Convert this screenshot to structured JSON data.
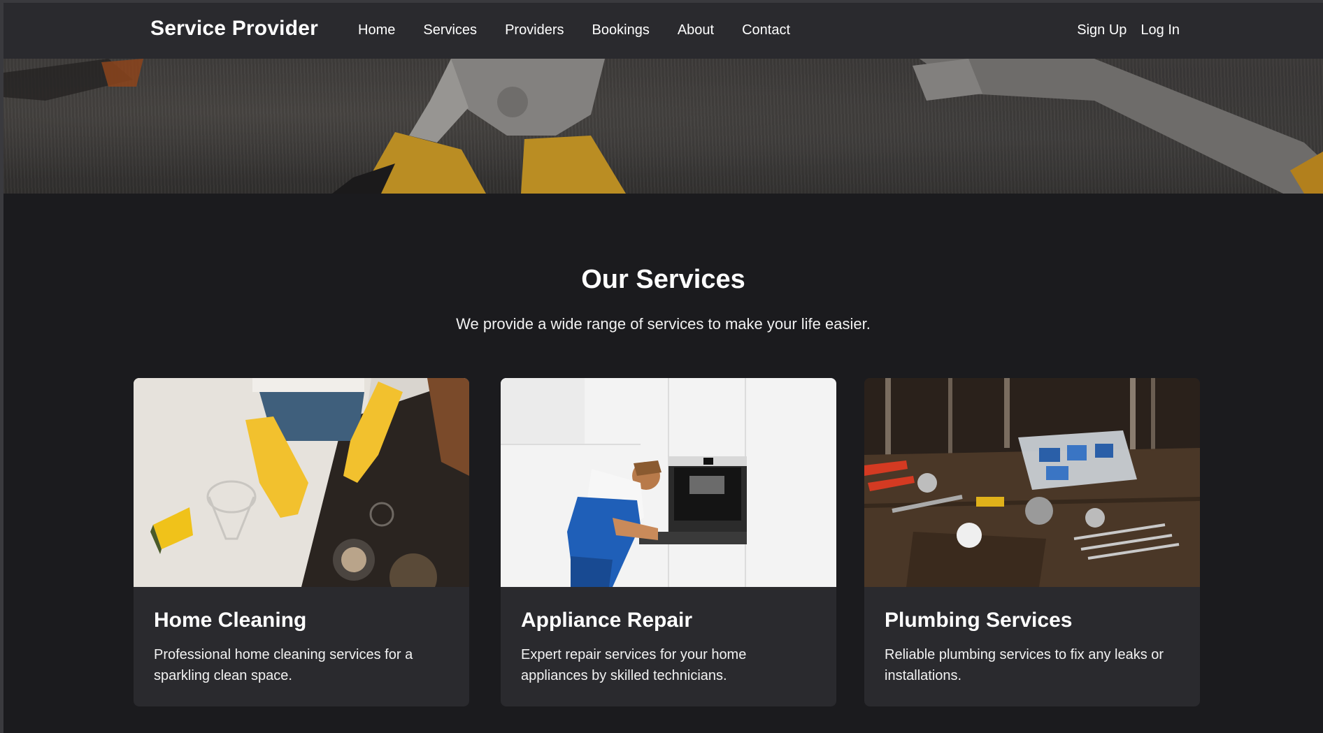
{
  "navbar": {
    "brand": "Service Provider",
    "links": [
      "Home",
      "Services",
      "Providers",
      "Bookings",
      "About",
      "Contact"
    ],
    "signup": "Sign Up",
    "login": "Log In"
  },
  "services": {
    "title": "Our Services",
    "subtitle": "We provide a wide range of services to make your life easier.",
    "cards": [
      {
        "title": "Home Cleaning",
        "description": "Professional home cleaning services for a sparkling clean space."
      },
      {
        "title": "Appliance Repair",
        "description": "Expert repair services for your home appliances by skilled technicians."
      },
      {
        "title": "Plumbing Services",
        "description": "Reliable plumbing services to fix any leaks or installations."
      }
    ]
  },
  "colors": {
    "background": "#1b1b1e",
    "navbar": "#2a2a2e",
    "card": "#2a2a2e",
    "text": "#ffffff",
    "glove_yellow": "#f2c12e",
    "overalls_blue": "#1f5fb8"
  }
}
